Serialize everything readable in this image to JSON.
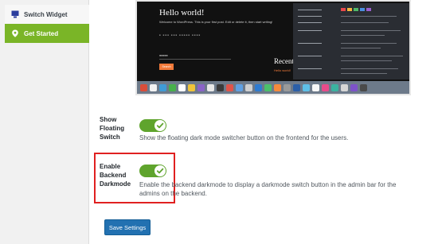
{
  "sidebar": {
    "items": [
      {
        "label": "Switch Widget",
        "icon": "monitor-icon",
        "active": false
      },
      {
        "label": "Get Started",
        "icon": "location-pin-icon",
        "active": true
      }
    ]
  },
  "preview": {
    "title": "Hello world!",
    "text": "Welcome to WordPress. This is your first post. Edit or delete it, then start writing!",
    "search_button": "Search",
    "recent_heading": "Recent",
    "recent_link": "Hello world!"
  },
  "settings": {
    "floating_switch": {
      "label": "Show Floating Switch",
      "enabled": true,
      "description": "Show the floating dark mode switcher button on the frontend for the users."
    },
    "backend_darkmode": {
      "label": "Enable Backend Darkmode",
      "enabled": true,
      "description": "Enable the backend darkmode to display a darkmode switch button in the admin bar for the admins on the backend."
    }
  },
  "save_button": "Save Settings",
  "colors": {
    "accent_green": "#7ab527",
    "toggle_green": "#5fa42d",
    "highlight_red": "#e02020",
    "button_blue": "#2271b1"
  }
}
